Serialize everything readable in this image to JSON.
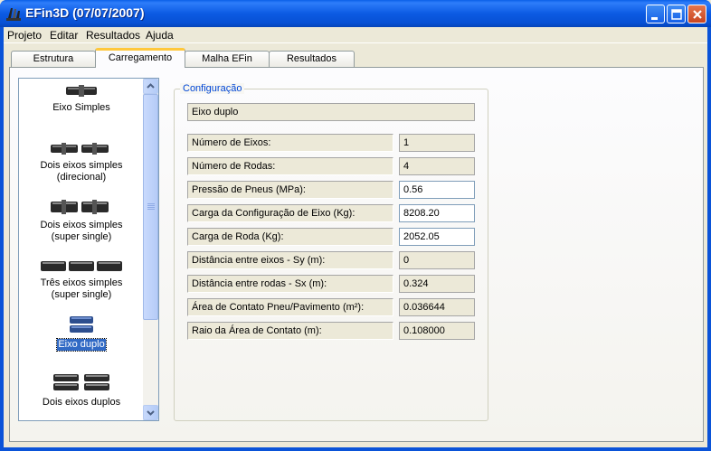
{
  "window": {
    "title": "EFin3D (07/07/2007)"
  },
  "menu": [
    {
      "label": "Projeto"
    },
    {
      "label": "Editar"
    },
    {
      "label": "Resultados"
    },
    {
      "label": "Ajuda"
    }
  ],
  "tabs": [
    {
      "label": "Estrutura",
      "active": false
    },
    {
      "label": "Carregamento",
      "active": true
    },
    {
      "label": "Malha EFin",
      "active": false
    },
    {
      "label": "Resultados",
      "active": false
    }
  ],
  "axle_list": [
    {
      "label": "Eixo Simples",
      "selected": false
    },
    {
      "label": "Dois eixos simples (direcional)",
      "selected": false
    },
    {
      "label": "Dois eixos simples (super single)",
      "selected": false
    },
    {
      "label": "Três eixos simples (super single)",
      "selected": false
    },
    {
      "label": "Eixo duplo",
      "selected": true
    },
    {
      "label": "Dois eixos duplos",
      "selected": false
    }
  ],
  "config": {
    "group_title": "Configuração",
    "selected_name": "Eixo duplo",
    "fields": [
      {
        "label": "Número de Eixos:",
        "value": "1",
        "editable": false
      },
      {
        "label": "Número de Rodas:",
        "value": "4",
        "editable": false
      },
      {
        "label": "Pressão de Pneus (MPa):",
        "value": "0.56",
        "editable": true
      },
      {
        "label": "Carga da Configuração de Eixo (Kg):",
        "value": "8208.20",
        "editable": true
      },
      {
        "label": "Carga de Roda (Kg):",
        "value": "2052.05",
        "editable": true
      },
      {
        "label": "Distância entre eixos - Sy (m):",
        "value": "0",
        "editable": false
      },
      {
        "label": "Distância entre rodas - Sx (m):",
        "value": "0.324",
        "editable": false
      },
      {
        "label": "Área de Contato Pneu/Pavimento (m²):",
        "value": "0.036644",
        "editable": false
      },
      {
        "label": "Raio da Área de Contato (m):",
        "value": "0.108000",
        "editable": false
      }
    ]
  },
  "colors": {
    "titlebar": "#0a5fe8",
    "selection": "#316ac5",
    "group_title": "#0046d5",
    "active_tab_accent": "#ffc83c"
  },
  "icons": {
    "app": "efin3d-app-icon",
    "minimize": "minimize-icon",
    "maximize": "maximize-icon",
    "close": "close-icon",
    "scroll_up": "chevron-up-icon",
    "scroll_down": "chevron-down-icon"
  }
}
